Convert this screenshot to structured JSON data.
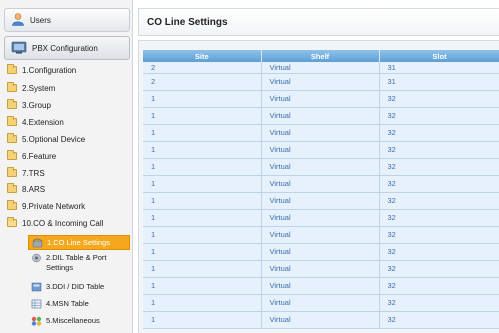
{
  "sidebar": {
    "users_label": "Users",
    "pbx_label": "PBX Configuration",
    "items": [
      {
        "label": "1.Configuration"
      },
      {
        "label": "2.System"
      },
      {
        "label": "3.Group"
      },
      {
        "label": "4.Extension"
      },
      {
        "label": "5.Optional Device"
      },
      {
        "label": "6.Feature"
      },
      {
        "label": "7.TRS"
      },
      {
        "label": "8.ARS"
      },
      {
        "label": "9.Private Network"
      },
      {
        "label": "10.CO & Incoming Call"
      }
    ],
    "sub_items": [
      {
        "label": "1.CO Line Settings"
      },
      {
        "label": "2.DIL Table & Port Settings"
      },
      {
        "label": "3.DDI / DID Table"
      },
      {
        "label": "4.MSN Table"
      },
      {
        "label": "5.Miscellaneous"
      }
    ]
  },
  "main": {
    "title": "CO Line Settings",
    "columns": [
      "Site",
      "Shelf",
      "Slot"
    ],
    "rows": [
      [
        "2",
        "Virtual",
        "31"
      ],
      [
        "2",
        "Virtual",
        "31"
      ],
      [
        "1",
        "Virtual",
        "32"
      ],
      [
        "1",
        "Virtual",
        "32"
      ],
      [
        "1",
        "Virtual",
        "32"
      ],
      [
        "1",
        "Virtual",
        "32"
      ],
      [
        "1",
        "Virtual",
        "32"
      ],
      [
        "1",
        "Virtual",
        "32"
      ],
      [
        "1",
        "Virtual",
        "32"
      ],
      [
        "1",
        "Virtual",
        "32"
      ],
      [
        "1",
        "Virtual",
        "32"
      ],
      [
        "1",
        "Virtual",
        "32"
      ],
      [
        "1",
        "Virtual",
        "32"
      ],
      [
        "1",
        "Virtual",
        "32"
      ],
      [
        "1",
        "Virtual",
        "32"
      ],
      [
        "1",
        "Virtual",
        "32"
      ]
    ]
  },
  "colors": {
    "header_blue": "#6aa9dd",
    "row_bg": "#e7f1fb",
    "cell_text": "#3a6fb0",
    "active_orange": "#f5a81e"
  }
}
